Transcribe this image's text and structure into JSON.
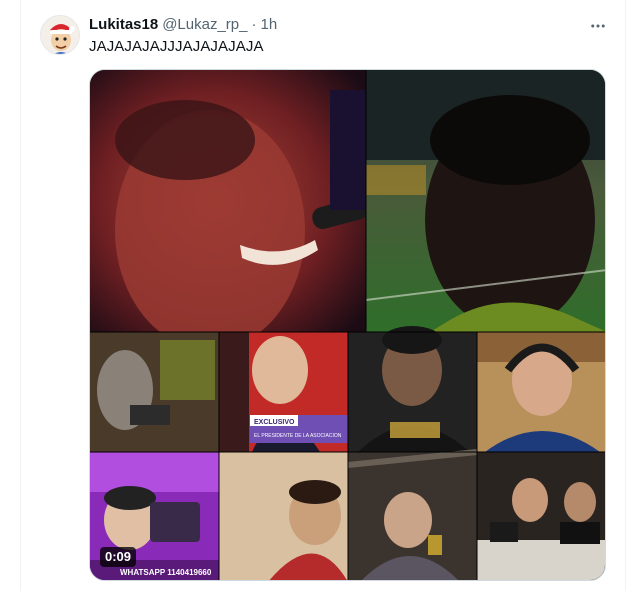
{
  "tweet": {
    "display_name": "Lukitas18",
    "handle": "@Lukaz_rp_",
    "separator": "·",
    "time": "1h",
    "text": "JAJAJAJAJJJAJAJAJAJA",
    "more_icon": "more-horizontal-icon"
  },
  "media": {
    "type": "video",
    "duration": "0:09",
    "panels": {
      "exclusive_banner": "EXCLUSIVO",
      "exclusive_sub": "EL PRESIDENTE DE LA ASOCIACION",
      "whatsapp_banner": "WHATSAPP 1140419660"
    }
  }
}
